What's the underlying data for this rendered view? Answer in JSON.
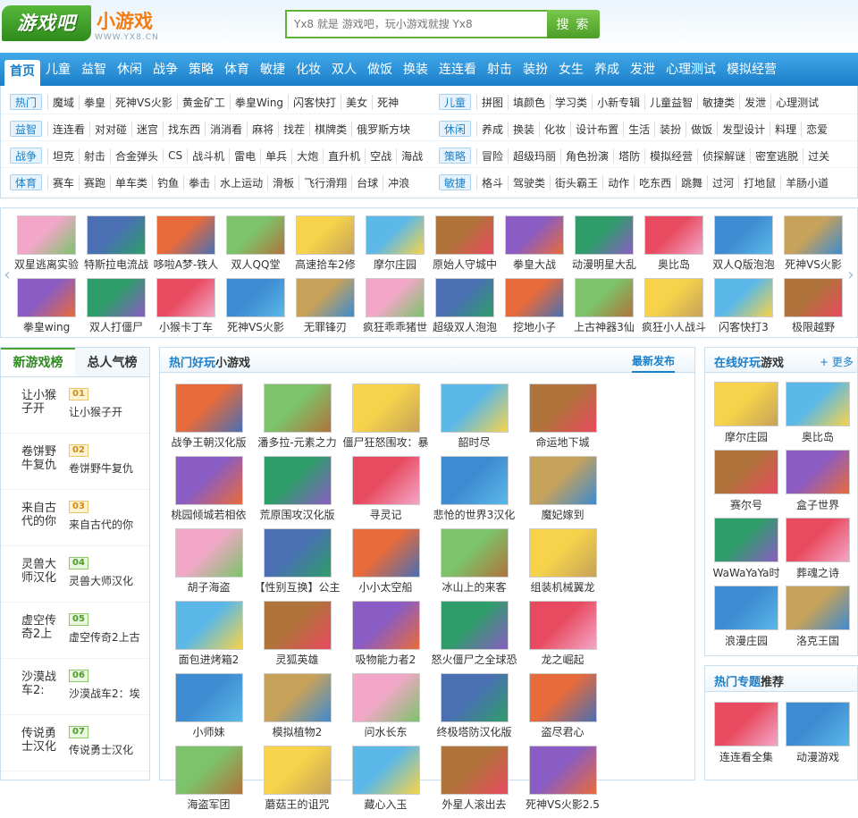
{
  "header": {
    "logo_text": "游戏吧",
    "logo_sub": "小游戏",
    "logo_url": "WWW.YX8.CN",
    "search_placeholder": "Yx8 就是 游戏吧，玩小游戏就搜 Yx8",
    "search_button": "搜 索"
  },
  "nav": [
    "首页",
    "儿童",
    "益智",
    "休闲",
    "战争",
    "策略",
    "体育",
    "敏捷",
    "化妆",
    "双人",
    "做饭",
    "换装",
    "连连看",
    "射击",
    "装扮",
    "女生",
    "养成",
    "发泄",
    "心理测试",
    "模拟经营"
  ],
  "categories": [
    {
      "tag": "热门",
      "links": [
        "魔域",
        "拳皇",
        "死神VS火影",
        "黄金矿工",
        "拳皇Wing",
        "闪客快打",
        "美女",
        "死神"
      ]
    },
    {
      "tag": "儿童",
      "links": [
        "拼图",
        "填颜色",
        "学习类",
        "小新专辑",
        "儿童益智",
        "敏捷类",
        "发泄",
        "心理测试"
      ]
    },
    {
      "tag": "益智",
      "links": [
        "连连看",
        "对对碰",
        "迷宫",
        "找东西",
        "消消看",
        "麻将",
        "找茬",
        "棋牌类",
        "俄罗斯方块"
      ]
    },
    {
      "tag": "休闲",
      "links": [
        "养成",
        "换装",
        "化妆",
        "设计布置",
        "生活",
        "装扮",
        "做饭",
        "发型设计",
        "料理",
        "恋爱"
      ]
    },
    {
      "tag": "战争",
      "links": [
        "坦克",
        "射击",
        "合金弹头",
        "CS",
        "战斗机",
        "雷电",
        "单兵",
        "大炮",
        "直升机",
        "空战",
        "海战"
      ]
    },
    {
      "tag": "策略",
      "links": [
        "冒险",
        "超级玛丽",
        "角色扮演",
        "塔防",
        "模拟经营",
        "侦探解谜",
        "密室逃脱",
        "过关"
      ]
    },
    {
      "tag": "体育",
      "links": [
        "赛车",
        "赛跑",
        "单车类",
        "钓鱼",
        "拳击",
        "水上运动",
        "滑板",
        "飞行滑翔",
        "台球",
        "冲浪"
      ]
    },
    {
      "tag": "敏捷",
      "links": [
        "格斗",
        "驾驶类",
        "街头霸王",
        "动作",
        "吃东西",
        "跳舞",
        "过河",
        "打地鼠",
        "羊肠小道"
      ]
    }
  ],
  "slider_row1": [
    "双星逃离实验",
    "特斯拉电流战",
    "哆啦A梦-铁人",
    "双人QQ堂",
    "高速拾车2修",
    "摩尔庄园",
    "原始人守城中",
    "拳皇大战",
    "动漫明星大乱",
    "奥比岛",
    "双人Q版泡泡",
    "死神VS火影"
  ],
  "slider_row2": [
    "拳皇wing",
    "双人打僵尸",
    "小猴卡丁车",
    "死神VS火影",
    "无罪锋刃",
    "疯狂乖乖猪世",
    "超级双人泡泡",
    "挖地小子",
    "上古神器3仙",
    "疯狂小人战斗",
    "闪客快打3",
    "极限越野"
  ],
  "left": {
    "tab_active": "新游戏榜",
    "tab_other": "总人气榜",
    "items": [
      {
        "title": "让小猴子开",
        "num": "01",
        "name": "让小猴子开"
      },
      {
        "title": "卷饼野牛复仇",
        "num": "02",
        "name": "卷饼野牛复仇"
      },
      {
        "title": "来自古代的你",
        "num": "03",
        "name": "来自古代的你"
      },
      {
        "title": "灵兽大师汉化",
        "num": "04",
        "name": "灵兽大师汉化"
      },
      {
        "title": "虚空传奇2上",
        "num": "05",
        "name": "虚空传奇2上古"
      },
      {
        "title": "沙漠战车2:",
        "num": "06",
        "name": "沙漠战车2：埃"
      },
      {
        "title": "传说勇士汉化",
        "num": "07",
        "name": "传说勇士汉化"
      }
    ]
  },
  "center": {
    "title_blue": "热门好玩",
    "title_rest": "小游戏",
    "more": "最新发布",
    "games": [
      "战争王朝汉化版",
      "潘多拉-元素之力",
      "僵尸狂怒围攻：暴",
      "韶时尽",
      "命运地下城",
      "桃园倾城若相依",
      "荒原围攻汉化版",
      "寻灵记",
      "悲怆的世界3汉化",
      "魔妃嫁到",
      "胡子海盗",
      "【性别互换】公主",
      "小小太空船",
      "冰山上的来客",
      "组装机械翼龙",
      "面包进烤箱2",
      "灵狐英雄",
      "吸物能力者2",
      "怒火僵尸之全球恐",
      "龙之崛起",
      "小师妹",
      "模拟植物2",
      "问水长东",
      "终极塔防汉化版",
      "盗尽君心",
      "海盗军团",
      "蘑菇王的诅咒",
      "藏心入玉",
      "外星人滚出去",
      "死神VS火影2.5"
    ]
  },
  "right": {
    "title_blue": "在线好玩",
    "title_rest": "游戏",
    "more": "+ 更多",
    "games": [
      "摩尔庄园",
      "奥比岛",
      "赛尔号",
      "盒子世界",
      "WaWaYaYa时",
      "葬魂之诗",
      "浪漫庄园",
      "洛克王国"
    ]
  },
  "topic": {
    "title_blue": "热门专题",
    "title_rest": "推荐",
    "items": [
      "连连看全集",
      "动漫游戏"
    ]
  }
}
